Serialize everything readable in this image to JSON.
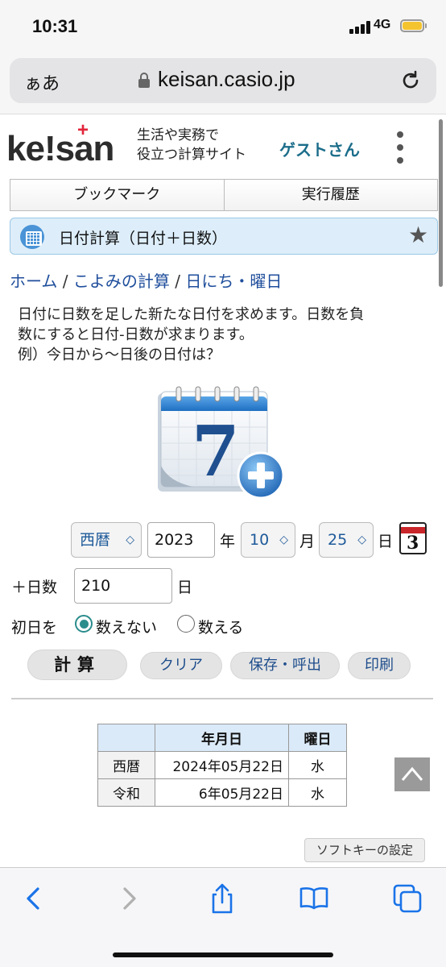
{
  "status": {
    "time": "10:31",
    "network": "4G"
  },
  "browser": {
    "aa": "ぁあ",
    "url": "keisan.casio.jp"
  },
  "site": {
    "logo": {
      "k": "ke",
      "bang": "!",
      "rest": "san",
      "plus": "+"
    },
    "tagline_line1": "生活や実務で",
    "tagline_line2": "役立つ計算サイト",
    "user": "ゲストさん"
  },
  "tabs": [
    "ブックマーク",
    "実行履歴"
  ],
  "page_title": "日付計算（日付＋日数）",
  "breadcrumb": {
    "home": "ホーム",
    "sep1": "/",
    "koyomi": "こよみの計算",
    "sep2": "/",
    "hinichi": "日にち・曜日"
  },
  "description": {
    "line1": "日付に日数を足した新たな日付を求めます。日数を負",
    "line2": "数にすると日付-日数が求まります。",
    "line3": "例）今日から～日後の日付は？"
  },
  "form": {
    "era": "西暦",
    "year": "2023",
    "year_label": "年",
    "month": "10",
    "month_label": "月",
    "day": "25",
    "day_label": "日",
    "calendar_num": "3",
    "days_label": "＋日数",
    "days_value": "210",
    "days_unit": "日",
    "first_day_label": "初日を",
    "option_exclude": "数えない",
    "option_include": "数える"
  },
  "buttons": {
    "calc": "計算",
    "clear": "クリア",
    "save": "保存・呼出",
    "print": "印刷"
  },
  "result": {
    "headers": [
      "",
      "年月日",
      "曜日"
    ],
    "rows": [
      {
        "era": "西暦",
        "date": "2024年05月22日",
        "weekday": "水"
      },
      {
        "era": "令和",
        "date": "6年05月22日",
        "weekday": "水"
      }
    ]
  },
  "softkey": "ソフトキーの設定"
}
